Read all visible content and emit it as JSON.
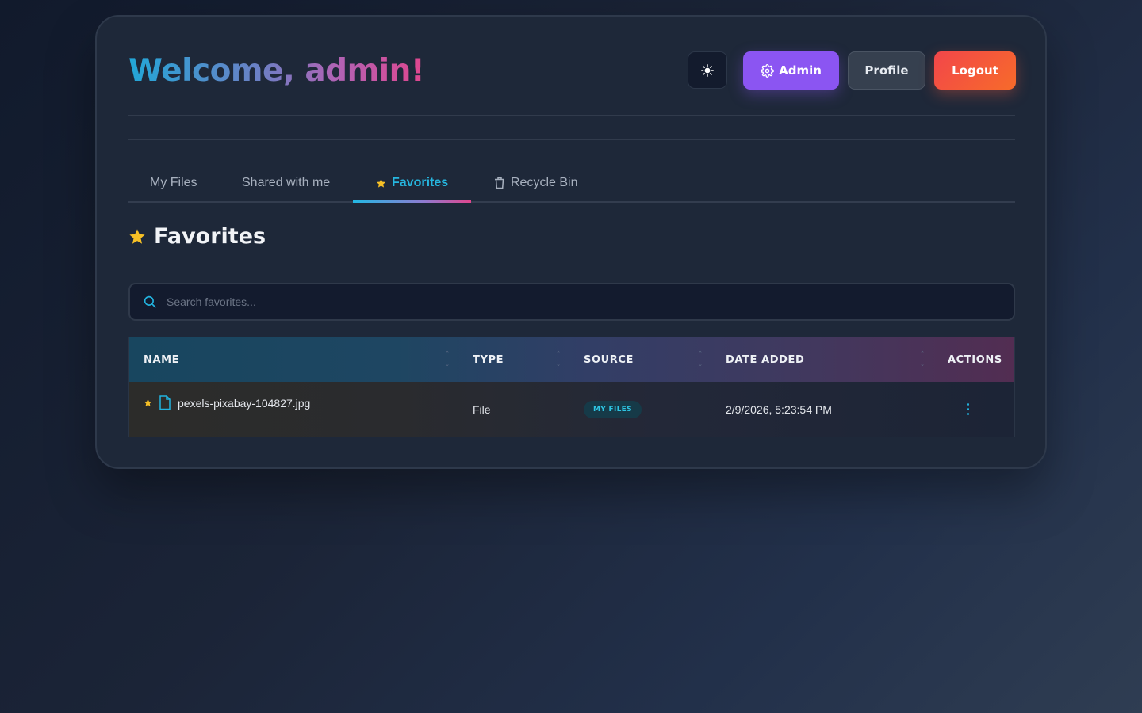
{
  "header": {
    "welcome_text": "Welcome, admin!",
    "buttons": {
      "theme_icon": "sun-icon",
      "admin_label": "Admin",
      "profile_label": "Profile",
      "logout_label": "Logout"
    }
  },
  "tabs": [
    {
      "label": "My Files",
      "active": false
    },
    {
      "label": "Shared with me",
      "active": false
    },
    {
      "label": "Favorites",
      "active": true,
      "icon": "star-icon"
    },
    {
      "label": "Recycle Bin",
      "active": false,
      "icon": "trash-icon"
    }
  ],
  "section": {
    "title": "Favorites",
    "icon": "star-icon"
  },
  "search": {
    "placeholder": "Search favorites...",
    "value": ""
  },
  "table": {
    "columns": [
      "NAME",
      "TYPE",
      "SOURCE",
      "DATE ADDED",
      "ACTIONS"
    ],
    "rows": [
      {
        "name": "pexels-pixabay-104827.jpg",
        "type": "File",
        "source": "MY FILES",
        "date_added": "2/9/2026, 5:23:54 PM",
        "starred": true
      }
    ]
  },
  "colors": {
    "accent_cyan": "#26b7e0",
    "admin_purple": "#8b55f2",
    "logout_orange": "#f55a3c",
    "star_yellow": "#f6c026"
  }
}
